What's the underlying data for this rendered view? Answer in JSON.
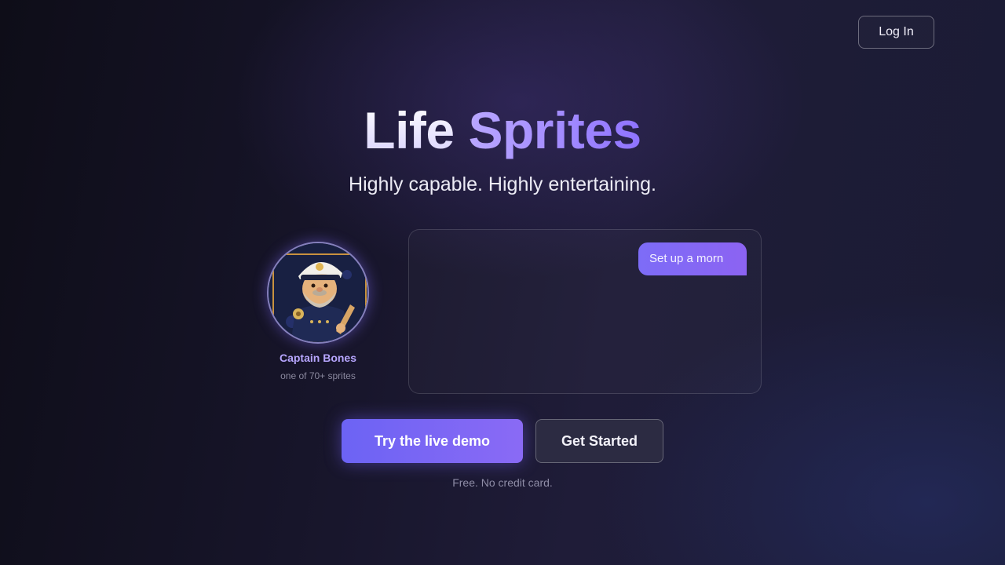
{
  "header": {
    "login_label": "Log In"
  },
  "hero": {
    "title_word1": "Life",
    "title_word2": "Sprites",
    "subtitle": "Highly capable. Highly entertaining."
  },
  "sprite": {
    "name": "Captain Bones",
    "note": "one of 70+ sprites",
    "icon": "captain-sprite-portrait"
  },
  "chat": {
    "user_message": "Set up a morn"
  },
  "cta": {
    "primary_label": "Try the live demo",
    "secondary_label": "Get Started",
    "fineprint": "Free. No credit card."
  },
  "colors": {
    "accent": "#7b67f6",
    "accent_light": "#b7a6ff",
    "background_dark": "#151327"
  }
}
